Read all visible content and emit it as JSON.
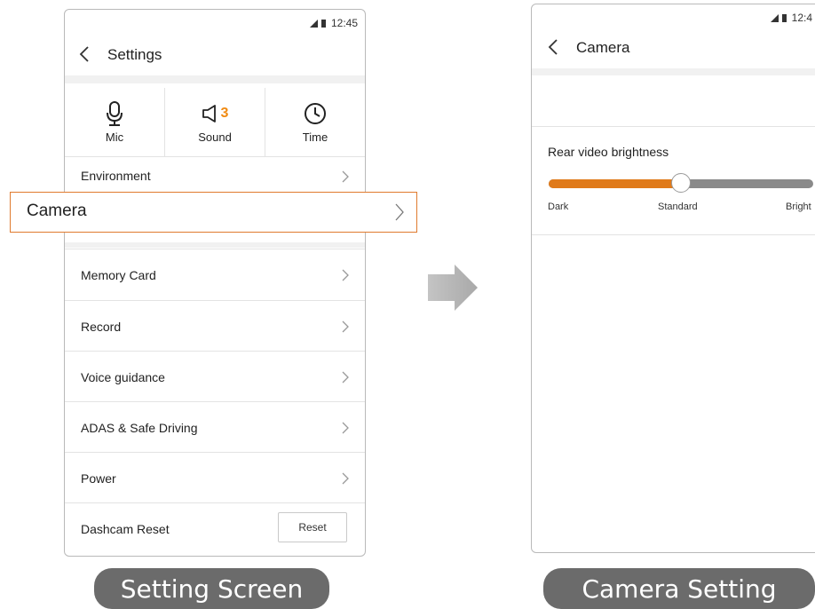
{
  "left_screen": {
    "status_time": "12:45",
    "title": "Settings",
    "quick": [
      {
        "label": "Mic",
        "icon": "mic-icon"
      },
      {
        "label": "Sound",
        "icon": "speaker-icon",
        "value": "3"
      },
      {
        "label": "Time",
        "icon": "clock-icon"
      }
    ],
    "rows": [
      {
        "label": "Environment"
      },
      {
        "label": "Memory Card"
      },
      {
        "label": "Record"
      },
      {
        "label": "Voice guidance"
      },
      {
        "label": "ADAS & Safe Driving"
      },
      {
        "label": "Power"
      },
      {
        "label": "Dashcam Reset",
        "button": "Reset"
      }
    ],
    "highlight": {
      "label": "Camera"
    },
    "caption": "Setting Screen"
  },
  "right_screen": {
    "status_time": "12:4",
    "title": "Camera",
    "setting_label": "Rear video brightness",
    "slider": {
      "min_label": "Dark",
      "mid_label": "Standard",
      "max_label": "Bright",
      "value_fraction": 0.5
    },
    "caption": "Camera Setting"
  },
  "colors": {
    "accent": "#f08a12",
    "slider_fill": "#e07a1a",
    "slider_track": "#8a8a8a",
    "highlight_border": "#e07a2e",
    "caption_bg": "#6b6b6b"
  }
}
